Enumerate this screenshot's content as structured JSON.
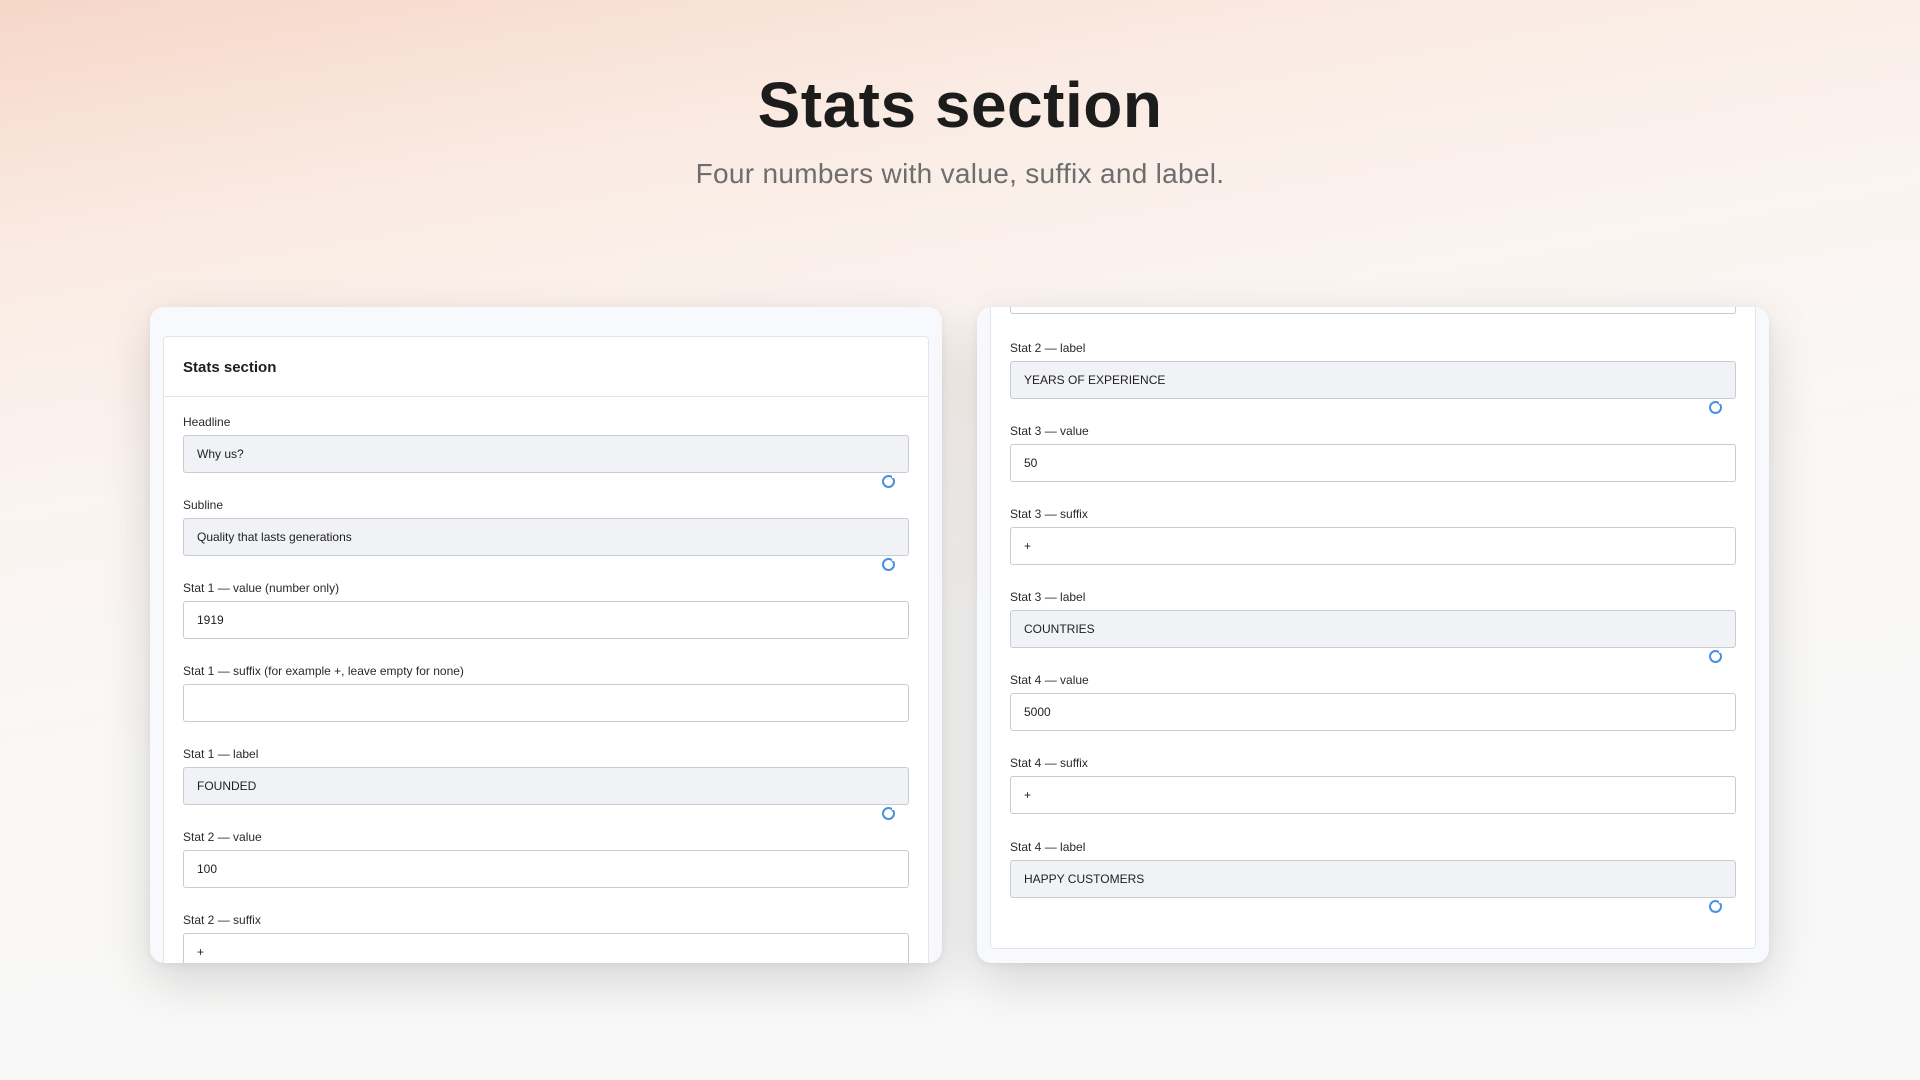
{
  "hero": {
    "title": "Stats section",
    "subtitle": "Four numbers with value, suffix and label."
  },
  "left_panel": {
    "card_title": "Stats section",
    "fields": [
      {
        "label": "Headline",
        "value": "Why us?",
        "type": "textarea"
      },
      {
        "label": "Subline",
        "value": "Quality that lasts generations",
        "type": "textarea"
      },
      {
        "label": "Stat 1 — value (number only)",
        "value": "1919",
        "type": "input"
      },
      {
        "label": "Stat 1 — suffix (for example +, leave empty for none)",
        "value": "",
        "type": "input"
      },
      {
        "label": "Stat 1 — label",
        "value": "FOUNDED",
        "type": "textarea"
      },
      {
        "label": "Stat 2 — value",
        "value": "100",
        "type": "input"
      },
      {
        "label": "Stat 2 — suffix",
        "value": "+",
        "type": "input"
      }
    ]
  },
  "right_panel": {
    "fields": [
      {
        "label": "Stat 2 — label",
        "value": "YEARS OF EXPERIENCE",
        "type": "textarea"
      },
      {
        "label": "Stat 3 — value",
        "value": "50",
        "type": "input"
      },
      {
        "label": "Stat 3 — suffix",
        "value": "+",
        "type": "input"
      },
      {
        "label": "Stat 3 — label",
        "value": "COUNTRIES",
        "type": "textarea"
      },
      {
        "label": "Stat 4 — value",
        "value": "5000",
        "type": "input"
      },
      {
        "label": "Stat 4 — suffix",
        "value": "+",
        "type": "input"
      },
      {
        "label": "Stat 4 — label",
        "value": "HAPPY CUSTOMERS",
        "type": "textarea"
      }
    ]
  },
  "icons": {
    "resize_handle": "textarea-resize-icon"
  },
  "colors": {
    "accent": "#4a90e2",
    "textarea_bg": "#f1f2f6",
    "border": "#c9ccd3"
  }
}
